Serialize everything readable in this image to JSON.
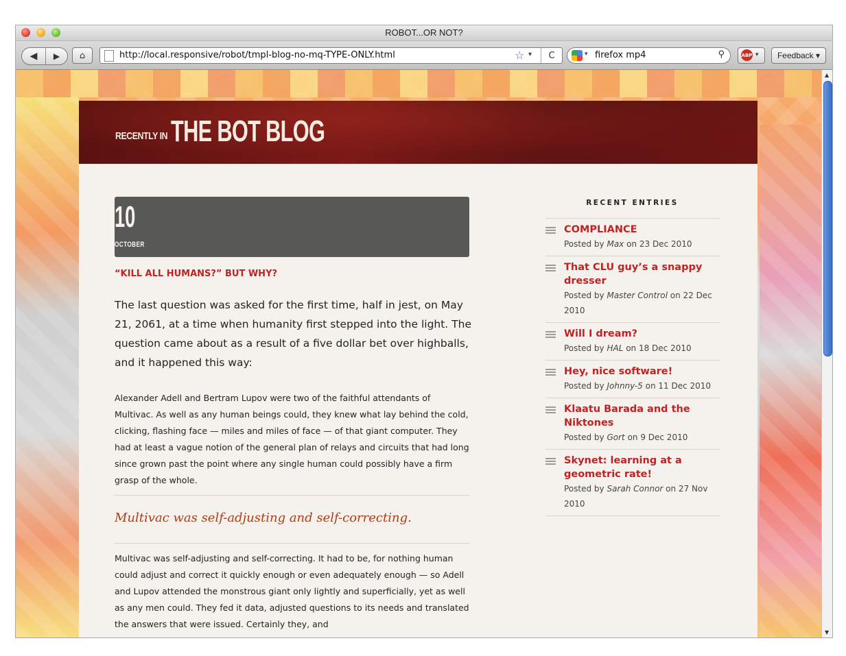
{
  "window": {
    "title": "ROBOT...OR NOT?"
  },
  "toolbar": {
    "back_icon": "◀",
    "forward_icon": "▶",
    "home_icon": "⌂",
    "url": "http://local.responsive/robot/tmpl-blog-no-mq-TYPE-ONLY.html",
    "bookmark_icon": "☆",
    "dropdown_icon": "▾",
    "reload_icon": "C",
    "search_value": "firefox mp4",
    "search_icon": "⚲",
    "adblock_label": "ABP",
    "feedback_label": "Feedback ▾"
  },
  "banner": {
    "prefix": "RECENTLY IN",
    "title": "THE BOT BLOG"
  },
  "post": {
    "day": "10",
    "month": "OCTOBER",
    "title": "“KILL ALL HUMANS?” BUT WHY?",
    "lead": "The last question was asked for the first time, half in jest, on May 21, 2061, at a time when humanity first stepped into the light. The question came about as a result of a five dollar bet over highballs, and it happened this way:",
    "para1": "Alexander Adell and Bertram Lupov were two of the faithful attendants of Multivac. As well as any human beings could, they knew what lay behind the cold, clicking, flashing face — miles and miles of face — of that giant computer. They had at least a vague notion of the general plan of relays and circuits that had long since grown past the point where any single human could possibly have a firm grasp of the whole.",
    "pullquote": "Multivac was self-adjusting and self-correcting.",
    "para2": "Multivac was self-adjusting and self-correcting. It had to be, for nothing human could adjust and correct it quickly enough or even adequately enough — so Adell and Lupov attended the monstrous giant only lightly and superficially, yet as well as any men could. They fed it data, adjusted questions to its needs and translated the answers that were issued. Certainly they, and"
  },
  "sidebar": {
    "heading": "RECENT ENTRIES",
    "entries": [
      {
        "title": "COMPLIANCE",
        "prefix": "Posted by ",
        "author": "Max",
        "date": " on 23 Dec 2010"
      },
      {
        "title": "That CLU guy’s a snappy dresser",
        "prefix": "Posted by ",
        "author": "Master Control",
        "date": " on 22 Dec 2010"
      },
      {
        "title": "Will I dream?",
        "prefix": "Posted by ",
        "author": "HAL",
        "date": " on 18 Dec 2010"
      },
      {
        "title": "Hey, nice software!",
        "prefix": "Posted by ",
        "author": "Johnny-5",
        "date": " on 11 Dec 2010"
      },
      {
        "title": "Klaatu Barada and the Niktones",
        "prefix": "Posted by ",
        "author": "Gort",
        "date": " on 9 Dec 2010"
      },
      {
        "title": "Skynet: learning at a geometric rate!",
        "prefix": "Posted by ",
        "author": "Sarah Connor",
        "date": " on 27 Nov 2010"
      }
    ]
  },
  "colors": {
    "accent_red": "#c22222",
    "banner": "#6a1614",
    "pullquote": "#a73f1c",
    "scroll_thumb": "#4a7ed4"
  }
}
